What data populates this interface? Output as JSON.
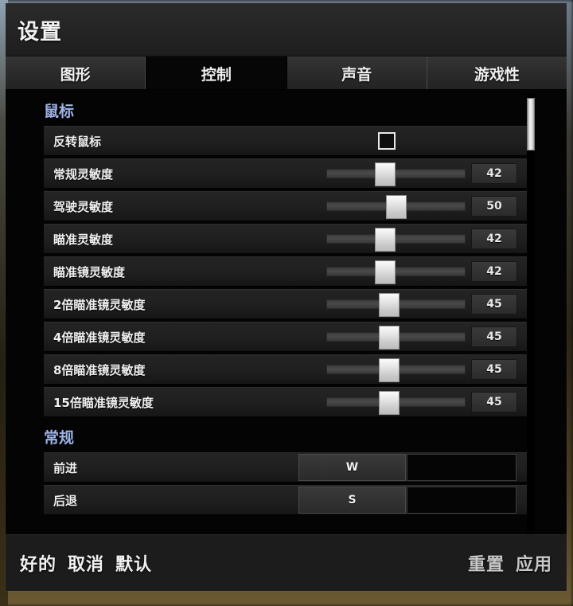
{
  "window": {
    "title": "设置"
  },
  "tabs": [
    {
      "label": "图形",
      "active": false
    },
    {
      "label": "控制",
      "active": true
    },
    {
      "label": "声音",
      "active": false
    },
    {
      "label": "游戏性",
      "active": false
    }
  ],
  "sections": [
    {
      "title": "鼠标",
      "rows": [
        {
          "type": "checkbox",
          "label": "反转鼠标",
          "checked": false
        },
        {
          "type": "slider",
          "label": "常规灵敏度",
          "value": "42",
          "percent": 42
        },
        {
          "type": "slider",
          "label": "驾驶灵敏度",
          "value": "50",
          "percent": 50
        },
        {
          "type": "slider",
          "label": "瞄准灵敏度",
          "value": "42",
          "percent": 42
        },
        {
          "type": "slider",
          "label": "瞄准镜灵敏度",
          "value": "42",
          "percent": 42
        },
        {
          "type": "slider",
          "label": "2倍瞄准镜灵敏度",
          "value": "45",
          "percent": 45
        },
        {
          "type": "slider",
          "label": "4倍瞄准镜灵敏度",
          "value": "45",
          "percent": 45
        },
        {
          "type": "slider",
          "label": "8倍瞄准镜灵敏度",
          "value": "45",
          "percent": 45
        },
        {
          "type": "slider",
          "label": "15倍瞄准镜灵敏度",
          "value": "45",
          "percent": 45
        }
      ]
    },
    {
      "title": "常规",
      "rows": [
        {
          "type": "keybind",
          "label": "前进",
          "primary": "W",
          "secondary": ""
        },
        {
          "type": "keybind",
          "label": "后退",
          "primary": "S",
          "secondary": ""
        }
      ]
    }
  ],
  "scrollbar": {
    "thumb_top_percent": 1,
    "thumb_height_percent": 12
  },
  "footer": {
    "left": [
      {
        "label": "好的"
      },
      {
        "label": "取消"
      },
      {
        "label": "默认"
      }
    ],
    "right": [
      {
        "label": "重置"
      },
      {
        "label": "应用"
      }
    ]
  },
  "colors": {
    "section_heading": "#9fb4e8",
    "row_background": "#1f1f1f",
    "active_tab": "#060606",
    "inactive_tab": "#2b2b2b",
    "slider_handle": "#e2e2e2"
  }
}
